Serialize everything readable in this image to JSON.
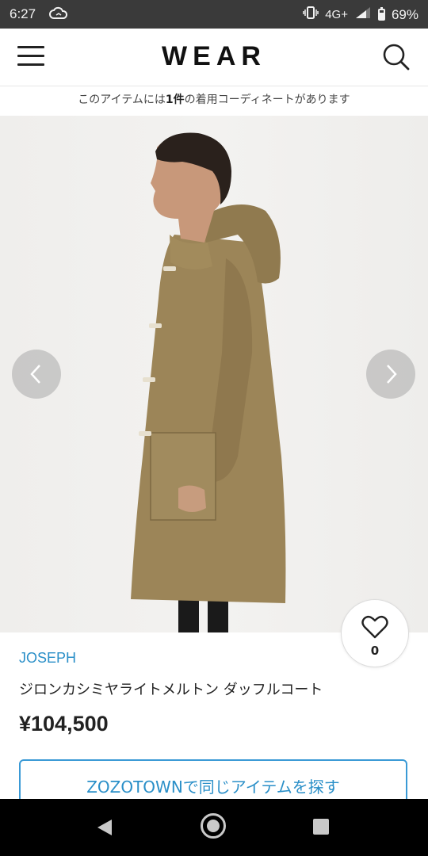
{
  "status_bar": {
    "time": "6:27",
    "network": "4G+",
    "battery": "69%",
    "battery_level": 0.69
  },
  "header": {
    "logo": "WEAR",
    "menu_icon": "hamburger-menu-icon",
    "search_icon": "search-icon"
  },
  "notice": {
    "prefix": "このアイテムには",
    "count": "1件",
    "suffix": "の着用コーディネートがあります"
  },
  "product": {
    "brand": "JOSEPH",
    "name": "ジロンカシミヤライトメルトン ダッフルコート",
    "price": "¥104,500",
    "favorite_count": "0",
    "coat_color": "#9c8558"
  },
  "actions": {
    "zozotown_button": "ZOZOTOWNで同じアイテムを探す"
  },
  "colors": {
    "accent_blue": "#2a8fc8",
    "status_bar": "#3a3a3a"
  }
}
